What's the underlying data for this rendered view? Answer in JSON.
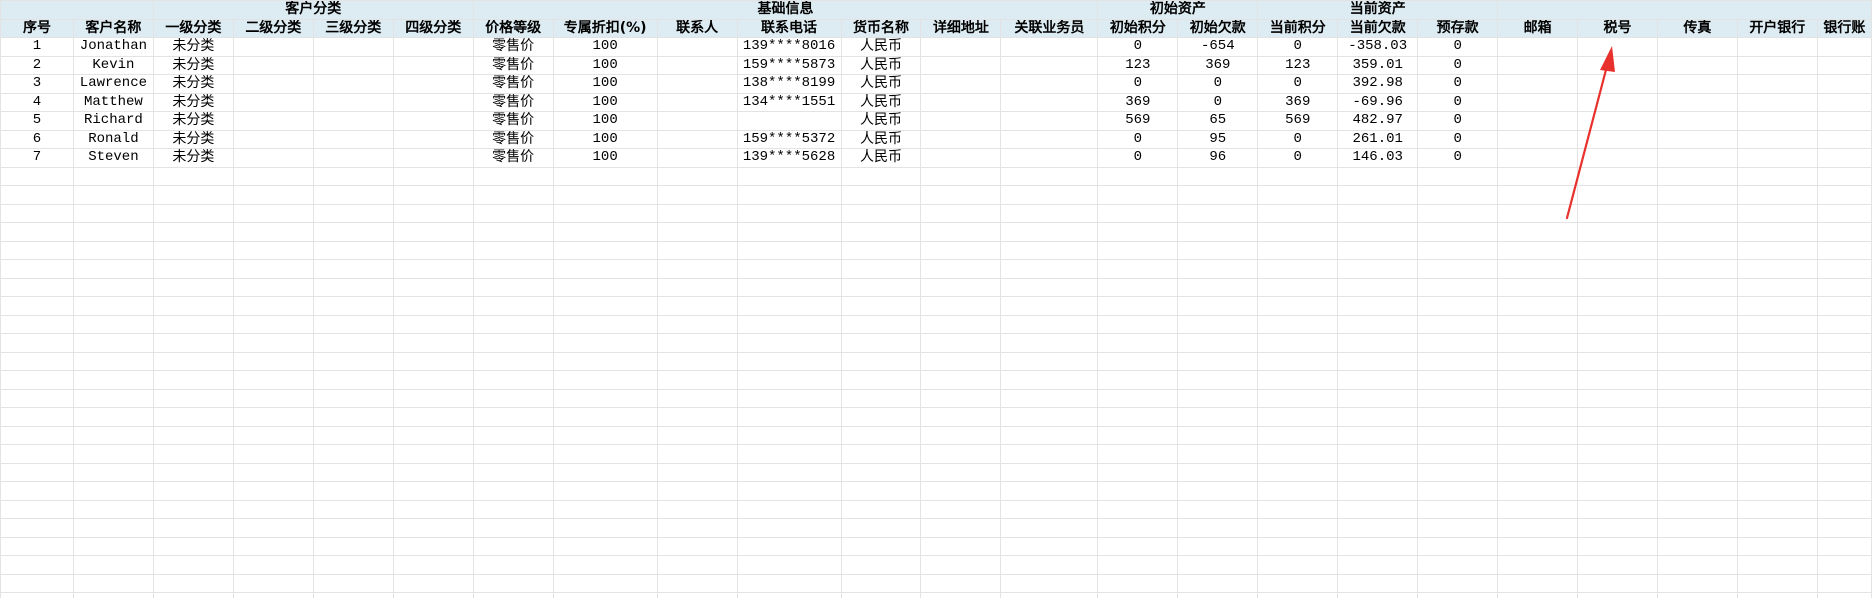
{
  "group_headers": [
    "客户分类",
    "基础信息",
    "初始资产",
    "当前资产"
  ],
  "column_headers": [
    "序号",
    "客户名称",
    "一级分类",
    "二级分类",
    "三级分类",
    "四级分类",
    "价格等级",
    "专属折扣(%)",
    "联系人",
    "联系电话",
    "货币名称",
    "详细地址",
    "关联业务员",
    "初始积分",
    "初始欠款",
    "当前积分",
    "当前欠款",
    "预存款",
    "邮箱",
    "税号",
    "传真",
    "开户银行",
    "银行账"
  ],
  "rows": [
    [
      "1",
      "Jonathan",
      "未分类",
      "",
      "",
      "",
      "零售价",
      "100",
      "",
      "139****8016",
      "人民币",
      "",
      "",
      "0",
      "-654",
      "0",
      "-358.03",
      "0",
      "",
      "",
      "",
      "",
      ""
    ],
    [
      "2",
      "Kevin",
      "未分类",
      "",
      "",
      "",
      "零售价",
      "100",
      "",
      "159****5873",
      "人民币",
      "",
      "",
      "123",
      "369",
      "123",
      "359.01",
      "0",
      "",
      "",
      "",
      "",
      ""
    ],
    [
      "3",
      "Lawrence",
      "未分类",
      "",
      "",
      "",
      "零售价",
      "100",
      "",
      "138****8199",
      "人民币",
      "",
      "",
      "0",
      "0",
      "0",
      "392.98",
      "0",
      "",
      "",
      "",
      "",
      ""
    ],
    [
      "4",
      "Matthew",
      "未分类",
      "",
      "",
      "",
      "零售价",
      "100",
      "",
      "134****1551",
      "人民币",
      "",
      "",
      "369",
      "0",
      "369",
      "-69.96",
      "0",
      "",
      "",
      "",
      "",
      ""
    ],
    [
      "5",
      "Richard",
      "未分类",
      "",
      "",
      "",
      "零售价",
      "100",
      "",
      "",
      "人民币",
      "",
      "",
      "569",
      "65",
      "569",
      "482.97",
      "0",
      "",
      "",
      "",
      "",
      ""
    ],
    [
      "6",
      "Ronald",
      "未分类",
      "",
      "",
      "",
      "零售价",
      "100",
      "",
      "159****5372",
      "人民币",
      "",
      "",
      "0",
      "95",
      "0",
      "261.01",
      "0",
      "",
      "",
      "",
      "",
      ""
    ],
    [
      "7",
      "Steven",
      "未分类",
      "",
      "",
      "",
      "零售价",
      "100",
      "",
      "139****5628",
      "人民币",
      "",
      "",
      "0",
      "96",
      "0",
      "146.03",
      "0",
      "",
      "",
      "",
      "",
      ""
    ]
  ],
  "colors": {
    "header_bg": "#dcecf2",
    "grid": "#e3e3e3",
    "arrow": "#e8302c"
  }
}
